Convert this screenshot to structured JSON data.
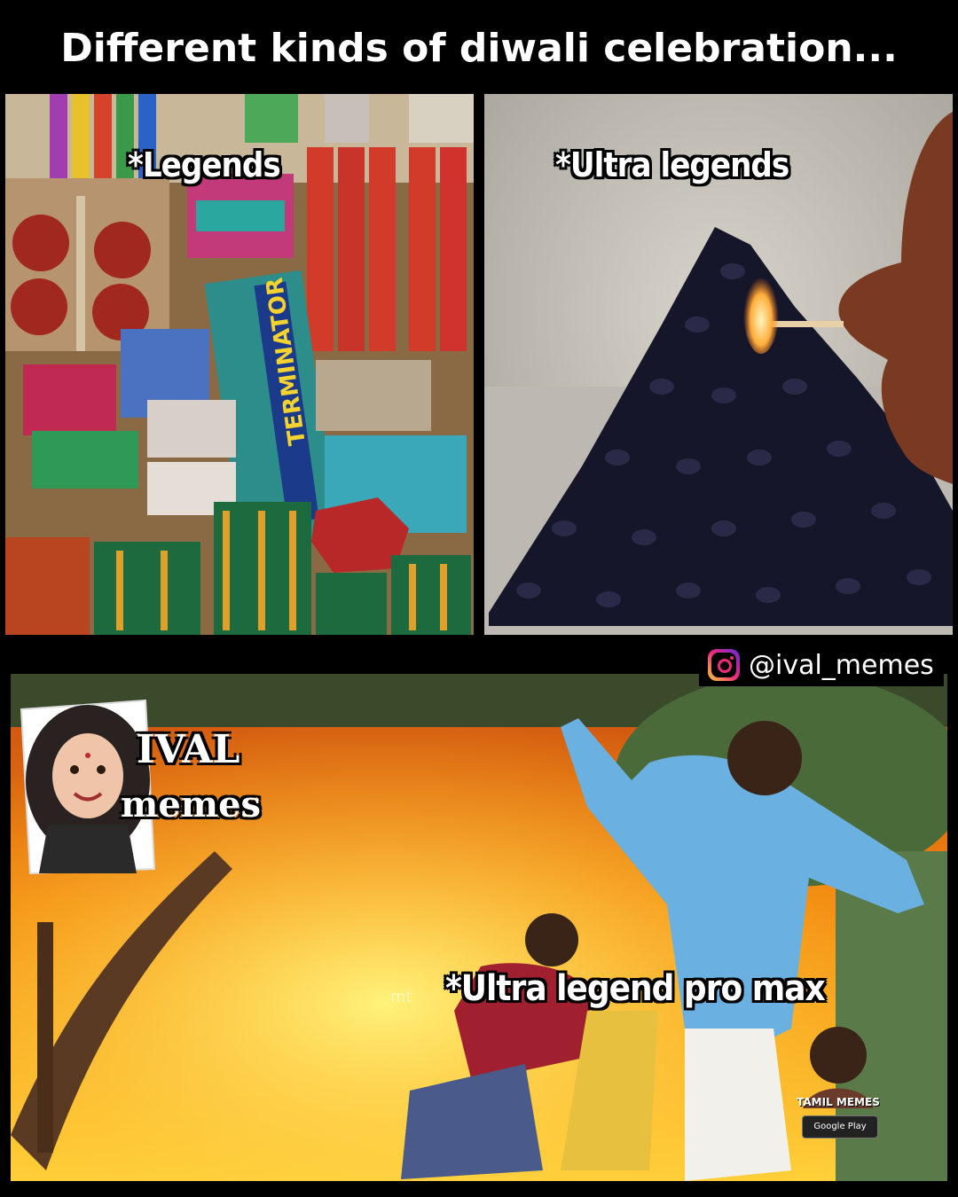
{
  "title": "Different kinds of diwali celebration...",
  "panels": {
    "top_left": {
      "label": "*Legends",
      "product_text": "TERMINATOR"
    },
    "top_right": {
      "label": "*Ultra legends"
    },
    "bottom": {
      "label": "*Ultra legend pro max",
      "watermark": "mt"
    }
  },
  "instagram": {
    "handle": "@ival_memes",
    "icon": "instagram-icon"
  },
  "sticker": {
    "line1": "IVAL",
    "line2": "memes"
  },
  "tamil_badge": {
    "text": "TAMIL MEMES",
    "store": "Google Play"
  }
}
